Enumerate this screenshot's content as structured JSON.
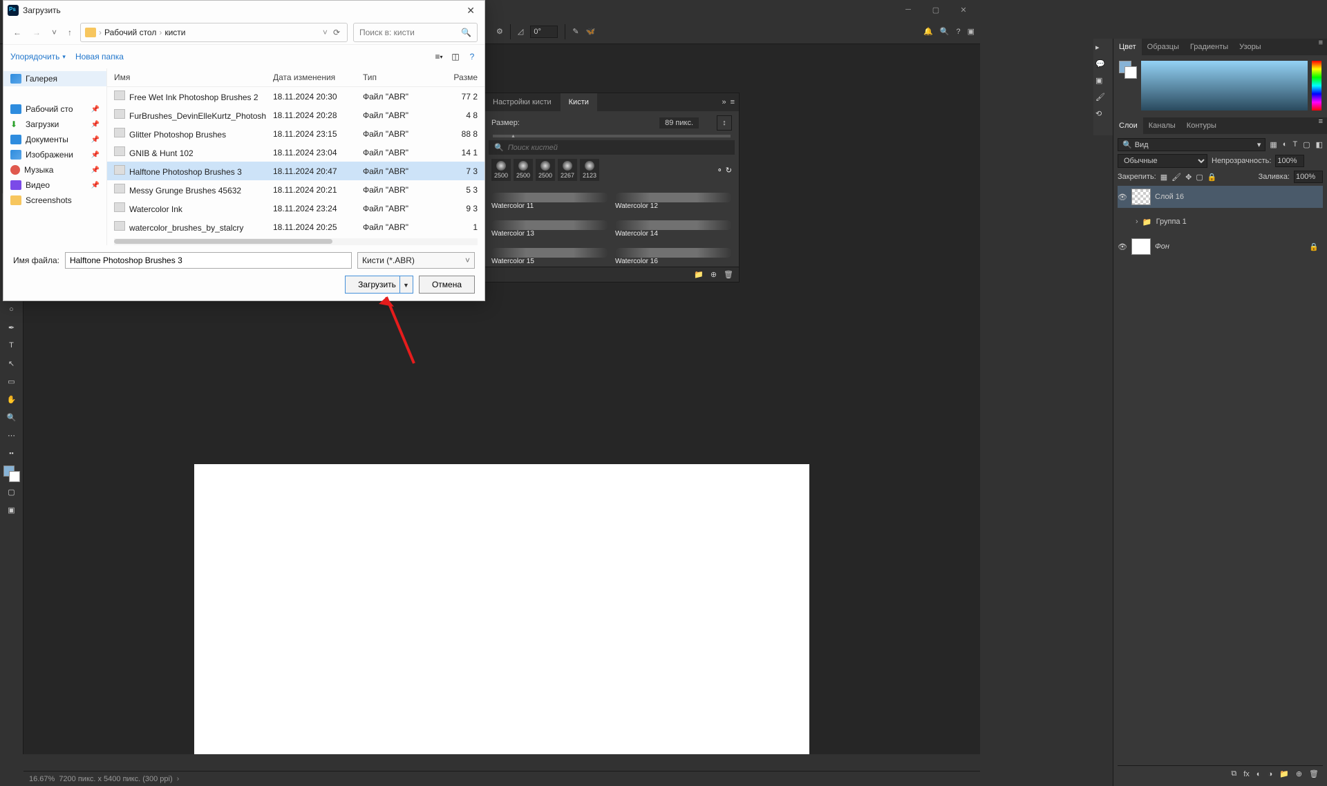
{
  "app": {
    "window_buttons": [
      "minimize",
      "maximize",
      "close"
    ]
  },
  "options_bar": {
    "angle_label": "0°"
  },
  "status": {
    "zoom": "16.67%",
    "doc": "7200 пикс. x 5400 пикс. (300 ppi)"
  },
  "brushes_panel": {
    "tabs": [
      "Настройки кисти",
      "Кисти"
    ],
    "active_tab": 1,
    "size_label": "Размер:",
    "size_value": "89 пикс.",
    "search_placeholder": "Поиск кистей",
    "tips": [
      "2500",
      "2500",
      "2500",
      "2267",
      "2123"
    ],
    "items": [
      "Watercolor 11",
      "Watercolor 12",
      "Watercolor 13",
      "Watercolor 14",
      "Watercolor 15",
      "Watercolor 16"
    ]
  },
  "color_panel": {
    "tabs": [
      "Цвет",
      "Образцы",
      "Градиенты",
      "Узоры"
    ],
    "active": 0
  },
  "layers_panel": {
    "tabs": [
      "Слои",
      "Каналы",
      "Контуры"
    ],
    "active": 0,
    "view_label": "Вид",
    "blend_mode": "Обычные",
    "opacity_label": "Непрозрачность:",
    "opacity_value": "100%",
    "lock_label": "Закрепить:",
    "fill_label": "Заливка:",
    "fill_value": "100%",
    "items": [
      {
        "name": "Слой 16",
        "thumb": "checker",
        "locked": false,
        "active": true,
        "visible": true
      },
      {
        "name": "Группа 1",
        "thumb": "folder",
        "locked": false,
        "active": false,
        "visible": false
      },
      {
        "name": "Фон",
        "thumb": "white",
        "locked": true,
        "active": false,
        "visible": true
      }
    ]
  },
  "file_dialog": {
    "title": "Загрузить",
    "breadcrumb": [
      "Рабочий стол",
      "кисти"
    ],
    "search_placeholder": "Поиск в: кисти",
    "toolbar": {
      "organize": "Упорядочить",
      "new_folder": "Новая папка"
    },
    "sidebar": {
      "gallery": "Галерея",
      "items": [
        "Рабочий сто",
        "Загрузки",
        "Документы",
        "Изображени",
        "Музыка",
        "Видео",
        "Screenshots"
      ]
    },
    "columns": [
      "Имя",
      "Дата изменения",
      "Тип",
      "Разме"
    ],
    "files": [
      {
        "name": "Free Wet Ink Photoshop Brushes 2",
        "date": "18.11.2024 20:30",
        "type": "Файл \"ABR\"",
        "size": "77 2"
      },
      {
        "name": "FurBrushes_DevinElleKurtz_Photoshop",
        "date": "18.11.2024 20:28",
        "type": "Файл \"ABR\"",
        "size": "4 8"
      },
      {
        "name": "Glitter Photoshop Brushes",
        "date": "18.11.2024 23:15",
        "type": "Файл \"ABR\"",
        "size": "88 8"
      },
      {
        "name": "GNIB & Hunt 102",
        "date": "18.11.2024 23:04",
        "type": "Файл \"ABR\"",
        "size": "14 1"
      },
      {
        "name": "Halftone Photoshop Brushes 3",
        "date": "18.11.2024 20:47",
        "type": "Файл \"ABR\"",
        "size": "7 3"
      },
      {
        "name": "Messy Grunge Brushes 45632",
        "date": "18.11.2024 20:21",
        "type": "Файл \"ABR\"",
        "size": "5 3"
      },
      {
        "name": "Watercolor Ink",
        "date": "18.11.2024 23:24",
        "type": "Файл \"ABR\"",
        "size": "9 3"
      },
      {
        "name": "watercolor_brushes_by_stalcry",
        "date": "18.11.2024 20:25",
        "type": "Файл \"ABR\"",
        "size": "1"
      }
    ],
    "selected_index": 4,
    "filename_label": "Имя файла:",
    "filename_value": "Halftone Photoshop Brushes 3",
    "filter_label": "Кисти (*.ABR)",
    "load_btn": "Загрузить",
    "cancel_btn": "Отмена"
  }
}
